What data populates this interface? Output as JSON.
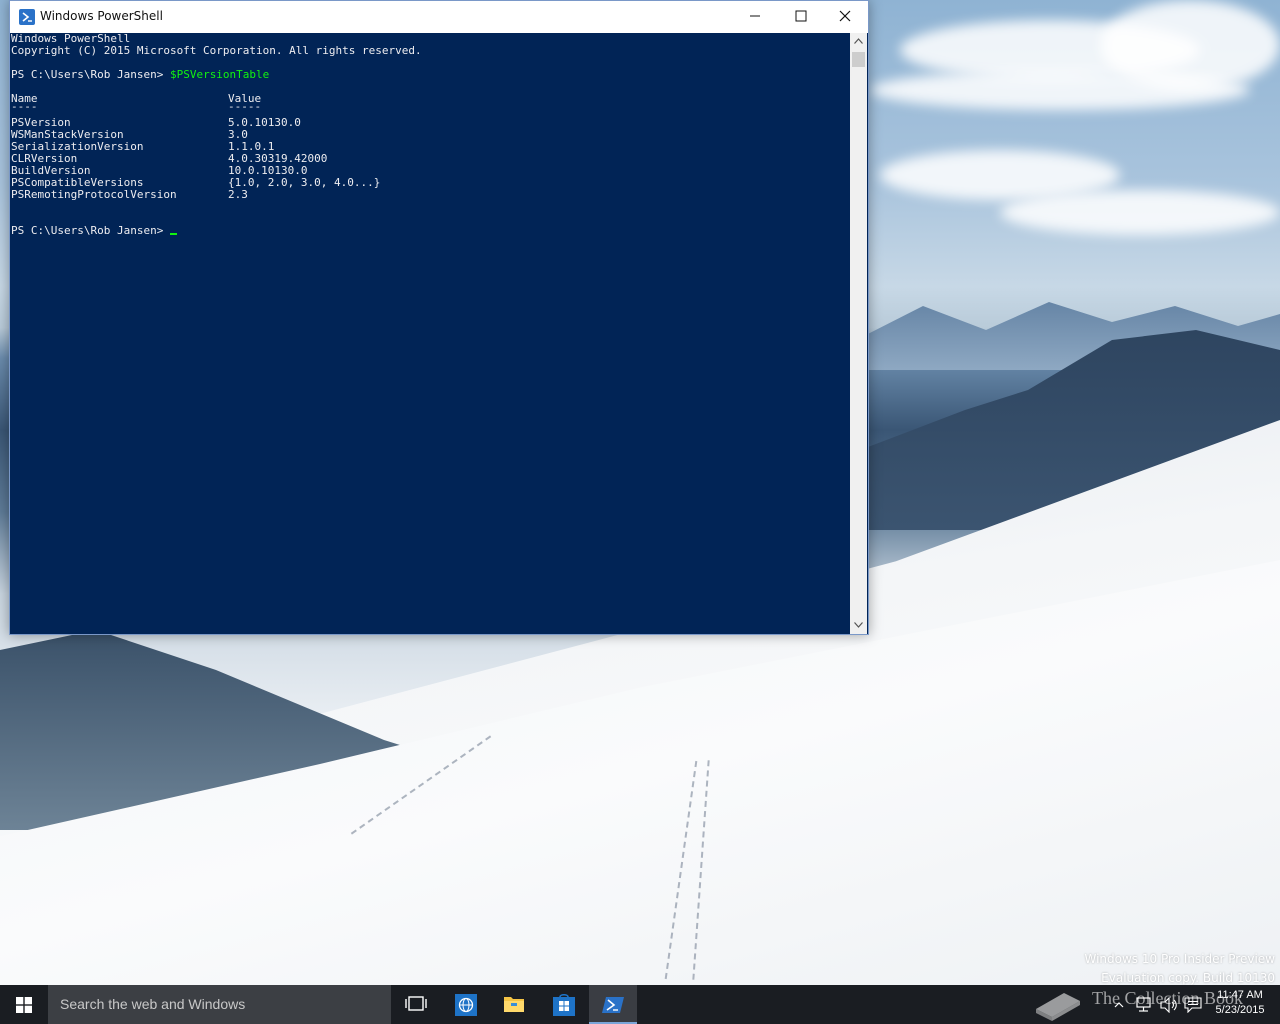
{
  "window": {
    "title": "Windows PowerShell"
  },
  "console": {
    "header_line1": "Windows PowerShell",
    "header_line2": "Copyright (C) 2015 Microsoft Corporation. All rights reserved.",
    "prompt1": "PS C:\\Users\\Rob Jansen> ",
    "command1": "$PSVersionTable",
    "table": {
      "col_name": "Name",
      "col_value": "Value",
      "sep_name": "----",
      "sep_value": "-----",
      "rows": [
        {
          "name": "PSVersion",
          "value": "5.0.10130.0"
        },
        {
          "name": "WSManStackVersion",
          "value": "3.0"
        },
        {
          "name": "SerializationVersion",
          "value": "1.1.0.1"
        },
        {
          "name": "CLRVersion",
          "value": "4.0.30319.42000"
        },
        {
          "name": "BuildVersion",
          "value": "10.0.10130.0"
        },
        {
          "name": "PSCompatibleVersions",
          "value": "{1.0, 2.0, 3.0, 4.0...}"
        },
        {
          "name": "PSRemotingProtocolVersion",
          "value": "2.3"
        }
      ]
    },
    "prompt2": "PS C:\\Users\\Rob Jansen> "
  },
  "watermark": {
    "line1": "Windows 10 Pro Insider Preview",
    "line2": "Evaluation copy. Build 10130"
  },
  "taskbar": {
    "search_placeholder": "Search the web and Windows",
    "brand_text": "The Collection Book",
    "time": "11:47 AM",
    "date": "5/23/2015"
  },
  "colors": {
    "console_bg": "#012456",
    "console_fg": "#eeedf0",
    "command_fg": "#12f30f",
    "taskbar_bg": "#1a1d22"
  },
  "icons": {
    "start": "windows-logo-icon",
    "task_view": "task-view-icon",
    "browser": "globe-icon",
    "explorer": "folder-icon",
    "store": "store-icon",
    "powershell": "powershell-icon"
  }
}
